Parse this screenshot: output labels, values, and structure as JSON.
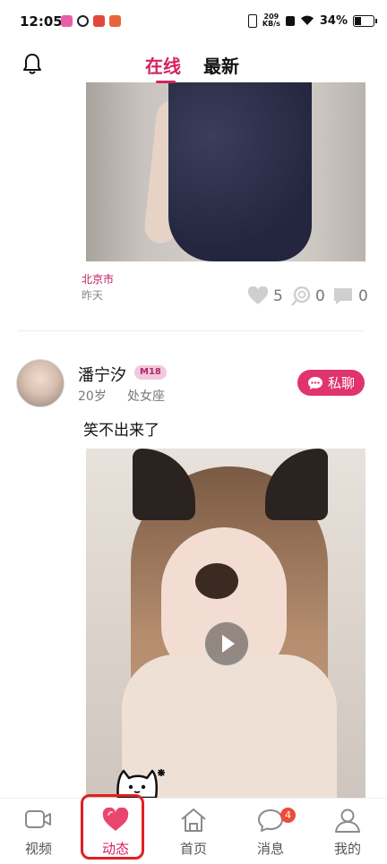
{
  "status_bar": {
    "time": "12:05",
    "net_speed_value": "209",
    "net_speed_unit": "KB/s",
    "battery": "34%",
    "battery_level": 0.34
  },
  "header": {
    "tabs": [
      {
        "label": "在线",
        "active": true
      },
      {
        "label": "最新",
        "active": false
      }
    ]
  },
  "post_top": {
    "location": "北京市",
    "date": "昨天",
    "likes": "5",
    "gifts": "0",
    "comments": "0"
  },
  "post_main": {
    "username": "潘宁汐",
    "badge": "M18",
    "age": "20岁",
    "zodiac": "处女座",
    "chat_label": "私聊",
    "caption": "笑不出来了"
  },
  "bottom_nav": {
    "items": [
      {
        "label": "视频",
        "icon": "video-camera-icon"
      },
      {
        "label": "动态",
        "icon": "heart-icon",
        "active": true
      },
      {
        "label": "首页",
        "icon": "home-icon"
      },
      {
        "label": "消息",
        "icon": "chat-bubble-icon",
        "badge": "4"
      },
      {
        "label": "我的",
        "icon": "person-icon"
      }
    ]
  },
  "colors": {
    "accent": "#d5225f",
    "chat_button": "#e0336f",
    "badge_red": "#ef4b37"
  }
}
